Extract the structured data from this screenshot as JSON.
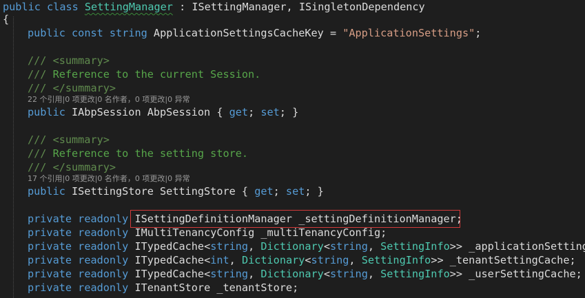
{
  "code": {
    "l0": {
      "kw1": "public",
      "kw2": "class",
      "name": "SettingManager",
      "sep": " : ",
      "if1": "ISettingManager",
      "comma": ", ",
      "if2": "ISingletonDependency"
    },
    "l1": {
      "brace": "{"
    },
    "l2": {
      "kw1": "public",
      "kw2": "const",
      "kw3": "string",
      "name": " ApplicationSettingsCacheKey = ",
      "str": "\"ApplicationSettings\"",
      "end": ";"
    },
    "l4": {
      "slashes": "///",
      "tag": " <summary>"
    },
    "l5": {
      "slashes": "///",
      "text": " Reference to the current Session."
    },
    "l6": {
      "slashes": "///",
      "tag": " </summary>"
    },
    "lens1": "22 个引用|0 项更改|0 名作者，0 项更改|0 异常",
    "l7": {
      "kw": "public",
      "type": " IAbpSession AbpSession { ",
      "get": "get",
      "sep1": "; ",
      "set": "set",
      "end": "; }"
    },
    "l9": {
      "slashes": "///",
      "tag": " <summary>"
    },
    "l10": {
      "slashes": "///",
      "text": " Reference to the setting store."
    },
    "l11": {
      "slashes": "///",
      "tag": " </summary>"
    },
    "lens2": "17 个引用|0 项更改|0 名作者，0 项更改|0 异常",
    "l12": {
      "kw": "public",
      "type": " ISettingStore SettingStore { ",
      "get": "get",
      "sep1": "; ",
      "set": "set",
      "end": "; }"
    },
    "l14": {
      "kw1": "private",
      "kw2": "readonly",
      "rest": "ISettingDefinitionManager _settingDefinitionManager;"
    },
    "l15": {
      "kw1": "private",
      "kw2": "readonly",
      "rest": "IMultiTenancyConfig _multiTenancyConfig;"
    },
    "l16": {
      "kw1": "private",
      "kw2": "readonly",
      "t1": "ITypedCache<",
      "k1": "string",
      "p1": ", ",
      "t2": "Dictionary",
      "p2": "<",
      "k2": "string",
      "p3": ", ",
      "t3": "SettingInfo",
      "p4": ">> _applicationSettingC"
    },
    "l17": {
      "kw1": "private",
      "kw2": "readonly",
      "t1": "ITypedCache<",
      "k1": "int",
      "p1": ", ",
      "t2": "Dictionary",
      "p2": "<",
      "k2": "string",
      "p3": ", ",
      "t3": "SettingInfo",
      "p4": ">> _tenantSettingCache;"
    },
    "l18": {
      "kw1": "private",
      "kw2": "readonly",
      "t1": "ITypedCache<",
      "k1": "string",
      "p1": ", ",
      "t2": "Dictionary",
      "p2": "<",
      "k2": "string",
      "p3": ", ",
      "t3": "SettingInfo",
      "p4": ">> _userSettingCache;"
    },
    "l19": {
      "kw1": "private",
      "kw2": "readonly",
      "rest": "ITenantStore _tenantStore;"
    }
  },
  "colors": {
    "background": "#1e1e1e",
    "keyword": "#569cd6",
    "comment": "#57a64a",
    "string": "#d69d85",
    "highlight_box": "#d23a3a"
  }
}
